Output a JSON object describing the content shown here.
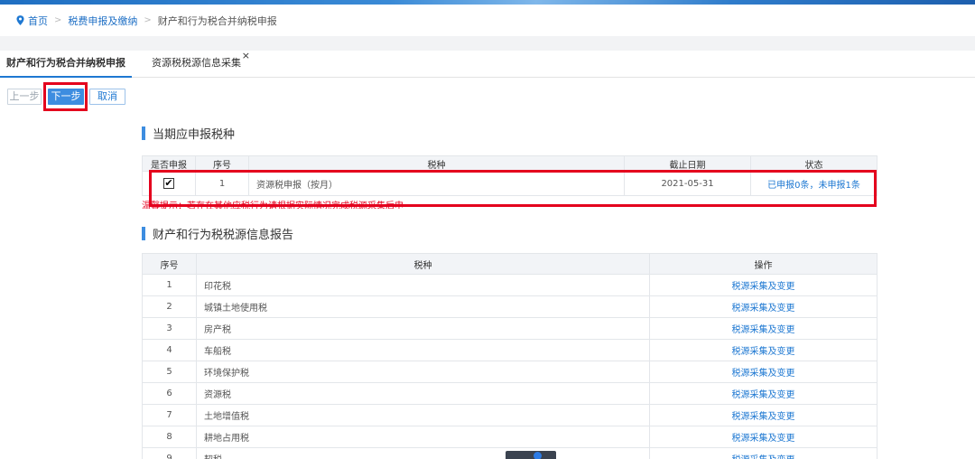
{
  "breadcrumb": {
    "home": "首页",
    "level1": "税费申报及缴纳",
    "current": "财产和行为税合并纳税申报",
    "separator": ">"
  },
  "tabs": [
    {
      "label": "财产和行为税合并纳税申报",
      "active": true
    },
    {
      "label": "资源税税源信息采集",
      "active": false,
      "close": "×"
    }
  ],
  "buttons": {
    "prev": "上一步",
    "next": "下一步",
    "cancel": "取消"
  },
  "section1": {
    "title": "当期应申报税种",
    "headers": [
      "是否申报",
      "序号",
      "税种",
      "截止日期",
      "状态"
    ],
    "row": {
      "checked": "✔",
      "index": "1",
      "tax": "资源税申报（按月）",
      "deadline": "2021-05-31",
      "status": "已申报0条，未申报1条"
    },
    "tip": "温馨提示：若存在其他应税行为请根据实际情况完成税源采集后申报！"
  },
  "section2": {
    "title": "财产和行为税税源信息报告",
    "headers": [
      "序号",
      "税种",
      "操作"
    ],
    "rows": [
      {
        "index": "1",
        "tax": "印花税",
        "op": "税源采集及变更"
      },
      {
        "index": "2",
        "tax": "城镇土地使用税",
        "op": "税源采集及变更"
      },
      {
        "index": "3",
        "tax": "房产税",
        "op": "税源采集及变更"
      },
      {
        "index": "4",
        "tax": "车船税",
        "op": "税源采集及变更"
      },
      {
        "index": "5",
        "tax": "环境保护税",
        "op": "税源采集及变更"
      },
      {
        "index": "6",
        "tax": "资源税",
        "op": "税源采集及变更"
      },
      {
        "index": "7",
        "tax": "土地增值税",
        "op": "税源采集及变更"
      },
      {
        "index": "8",
        "tax": "耕地占用税",
        "op": "税源采集及变更"
      },
      {
        "index": "9",
        "tax": "契税",
        "op": "税源采集及变更"
      }
    ]
  },
  "colors": {
    "accent": "#3d8de0",
    "link": "#1e78d2",
    "highlight": "#e4001d"
  }
}
